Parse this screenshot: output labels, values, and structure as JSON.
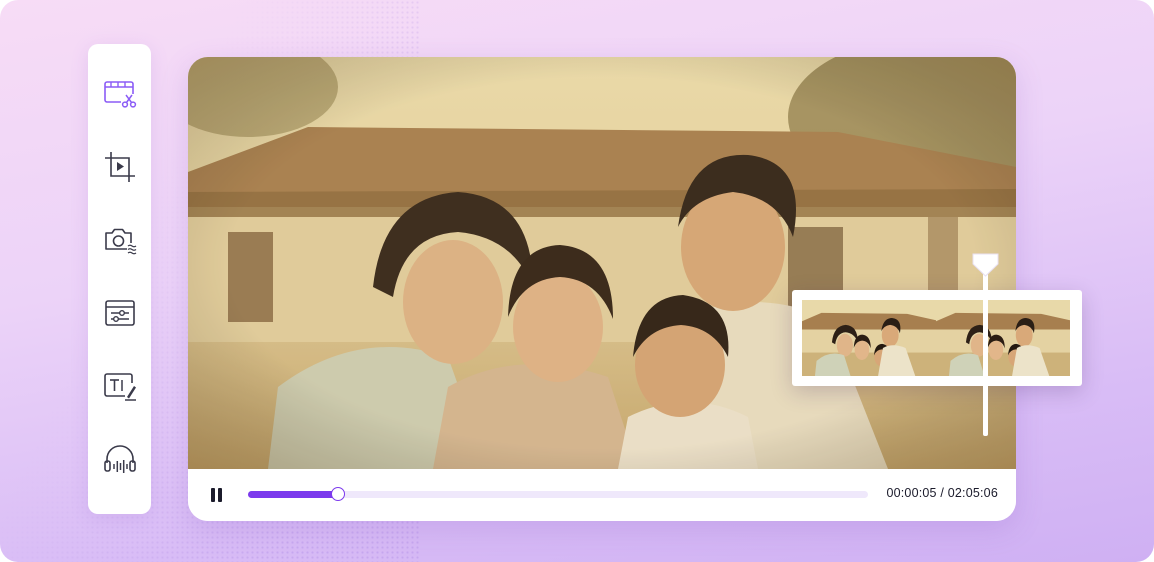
{
  "sidebar": {
    "tools": [
      {
        "icon": "video-cut-icon",
        "active": true
      },
      {
        "icon": "video-crop-icon",
        "active": false
      },
      {
        "icon": "camera-settings-icon",
        "active": false
      },
      {
        "icon": "adjust-sliders-icon",
        "active": false
      },
      {
        "icon": "text-edit-icon",
        "active": false
      },
      {
        "icon": "headphones-audio-icon",
        "active": false
      }
    ]
  },
  "player": {
    "time_display": "00:00:05 / 02:05:06",
    "progress": 0.145,
    "state": "playing"
  },
  "colors": {
    "accent": "#7c3aed",
    "sidebar_active": "#8b5cf6",
    "icon": "#3a3a4a"
  }
}
